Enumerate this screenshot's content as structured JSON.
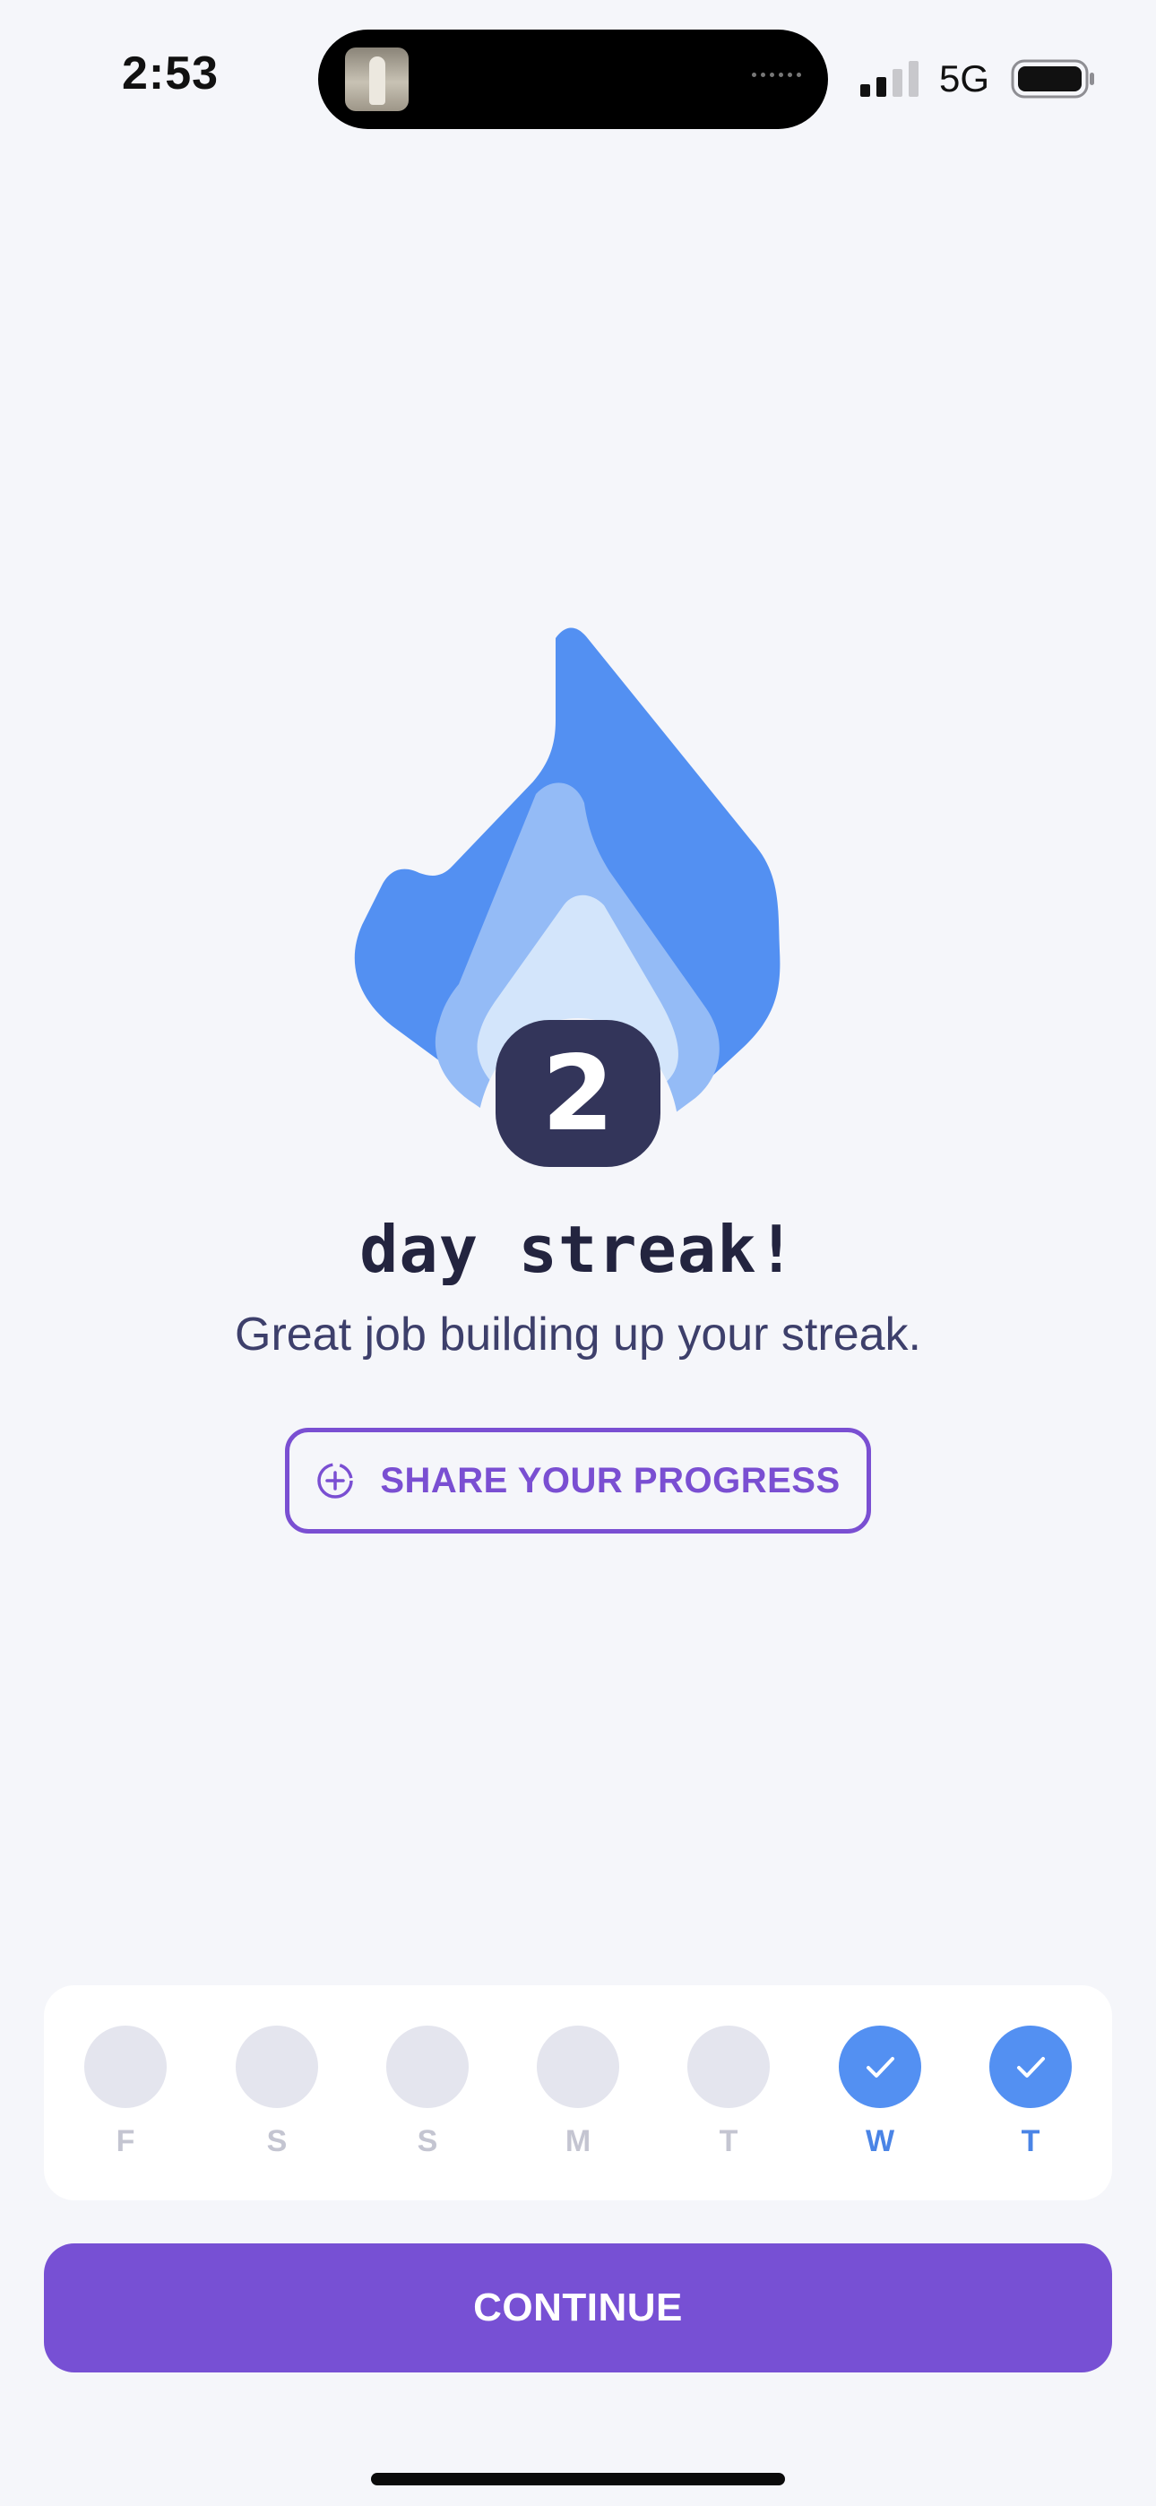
{
  "status_bar": {
    "time": "2:53",
    "network": "5G",
    "signal_bars_active": 2,
    "signal_bars_total": 4,
    "battery_icon": "battery-full-icon"
  },
  "streak": {
    "count": "2",
    "title": "day streak!",
    "subtitle": "Great job building up your streak.",
    "flame_icon": "flame-icon",
    "flame_colors": {
      "outer": "#5390f2",
      "middle": "#94bbf6",
      "inner": "#d3e5fb",
      "badge": "#33355a"
    }
  },
  "share": {
    "label": "SHARE YOUR PROGRESS",
    "icon": "share-plus-icon",
    "color": "#7a4fd2"
  },
  "week": {
    "days": [
      {
        "letter": "F",
        "completed": false
      },
      {
        "letter": "S",
        "completed": false
      },
      {
        "letter": "S",
        "completed": false
      },
      {
        "letter": "M",
        "completed": false
      },
      {
        "letter": "T",
        "completed": false
      },
      {
        "letter": "W",
        "completed": true
      },
      {
        "letter": "T",
        "completed": true
      }
    ],
    "done_color": "#5390f2"
  },
  "continue": {
    "label": "CONTINUE",
    "color": "#7750d4"
  }
}
